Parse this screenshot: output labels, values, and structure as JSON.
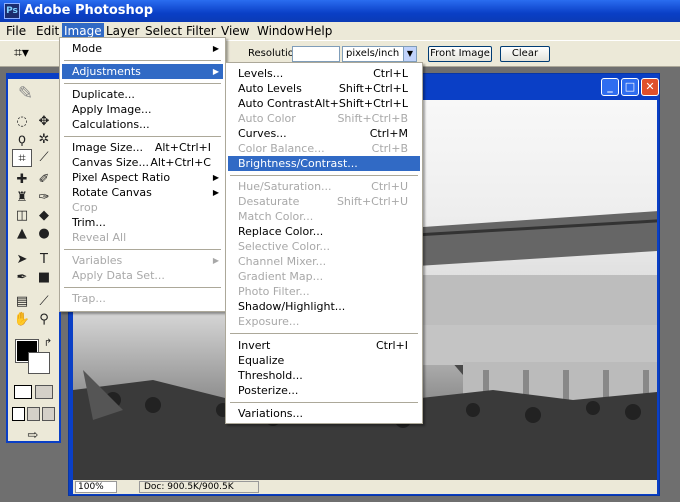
{
  "window": {
    "title": "Adobe Photoshop",
    "icon": "photoshop-icon"
  },
  "menubar": [
    "File",
    "Edit",
    "Image",
    "Layer",
    "Select",
    "Filter",
    "View",
    "Window",
    "Help"
  ],
  "options": {
    "resolution_label": "Resolution:",
    "resolution_value": "",
    "unit": "pixels/inch",
    "front_image": "Front Image",
    "clear": "Clear"
  },
  "image_menu": [
    "Mode",
    "Adjustments",
    "Duplicate...",
    "Apply Image...",
    "Calculations...",
    "Image Size...",
    "Alt+Ctrl+I",
    "Canvas Size...",
    "Alt+Ctrl+C",
    "Pixel Aspect Ratio",
    "Rotate Canvas",
    "Crop",
    "Trim...",
    "Reveal All",
    "Variables",
    "Apply Data Set...",
    "Trap..."
  ],
  "adjust_menu": [
    "Levels...",
    "Ctrl+L",
    "Auto Levels",
    "Shift+Ctrl+L",
    "Auto Contrast",
    "Alt+Shift+Ctrl+L",
    "Auto Color",
    "Shift+Ctrl+B",
    "Curves...",
    "Ctrl+M",
    "Color Balance...",
    "Ctrl+B",
    "Brightness/Contrast...",
    "Hue/Saturation...",
    "Ctrl+U",
    "Desaturate",
    "Shift+Ctrl+U",
    "Match Color...",
    "Replace Color...",
    "Selective Color...",
    "Channel Mixer...",
    "Gradient Map...",
    "Photo Filter...",
    "Shadow/Highlight...",
    "Exposure...",
    "Invert",
    "Ctrl+I",
    "Equalize",
    "Threshold...",
    "Posterize...",
    "Variations..."
  ],
  "status": {
    "zoom": "100%",
    "doc": "Doc: 900.5K/900.5K"
  },
  "colors": {
    "highlight": "#316ac5",
    "titlebar": "#0a3fc6",
    "menu_bg": "#ece9d8"
  }
}
